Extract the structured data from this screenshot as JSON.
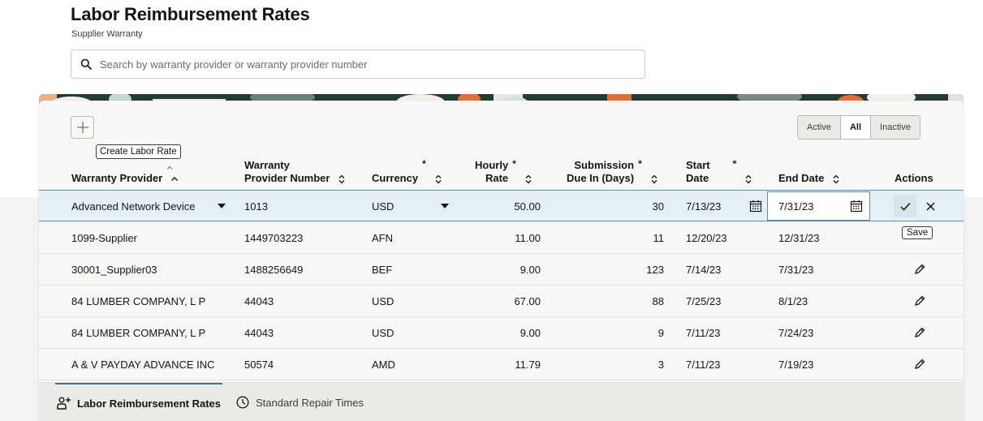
{
  "header": {
    "title": "Labor Reimbursement Rates",
    "subtitle": "Supplier Warranty"
  },
  "search": {
    "placeholder": "Search by warranty provider or warranty provider number",
    "icon": "search-icon"
  },
  "toolbar": {
    "add_tooltip": "Create Labor Rate",
    "filters": [
      {
        "label": "Active",
        "selected": false
      },
      {
        "label": "All",
        "selected": true
      },
      {
        "label": "Inactive",
        "selected": false
      }
    ]
  },
  "table": {
    "columns": {
      "provider": "Warranty Provider",
      "provider_number_1": "Warranty",
      "provider_number_2": "Provider Number",
      "currency": "Currency",
      "rate_1": "Hourly",
      "rate_2": "Rate",
      "due_1": "Submission",
      "due_2": "Due In (Days)",
      "start_1": "Start",
      "start_2": "Date",
      "end": "End Date",
      "actions": "Actions",
      "required_mark": "*"
    },
    "edit_row": {
      "provider": "Advanced Network Device",
      "number": "1013",
      "currency": "USD",
      "rate": "50.00",
      "due": "30",
      "start": "7/13/23",
      "end": "7/31/23",
      "save_tooltip": "Save"
    },
    "rows": [
      {
        "provider": "1099-Supplier",
        "number": "1449703223",
        "currency": "AFN",
        "rate": "11.00",
        "due": "11",
        "start": "12/20/23",
        "end": "12/31/23"
      },
      {
        "provider": "30001_Supplier03",
        "number": "1488256649",
        "currency": "BEF",
        "rate": "9.00",
        "due": "123",
        "start": "7/14/23",
        "end": "7/31/23"
      },
      {
        "provider": "84 LUMBER COMPANY, L P",
        "number": "44043",
        "currency": "USD",
        "rate": "67.00",
        "due": "88",
        "start": "7/25/23",
        "end": "8/1/23"
      },
      {
        "provider": "84 LUMBER COMPANY, L P",
        "number": "44043",
        "currency": "USD",
        "rate": "9.00",
        "due": "9",
        "start": "7/11/23",
        "end": "7/24/23"
      },
      {
        "provider": "A & V PAYDAY ADVANCE INC",
        "number": "50574",
        "currency": "AMD",
        "rate": "11.79",
        "due": "3",
        "start": "7/11/23",
        "end": "7/19/23"
      }
    ]
  },
  "tabs": [
    {
      "label": "Labor Reimbursement Rates",
      "icon": "labor-rates-icon",
      "active": true
    },
    {
      "label": "Standard Repair Times",
      "icon": "clock-icon",
      "active": false
    }
  ],
  "colors": {
    "accent": "#227e9e",
    "edit_row_bg": "#e4f0f5",
    "edit_border": "#5b8cab"
  }
}
